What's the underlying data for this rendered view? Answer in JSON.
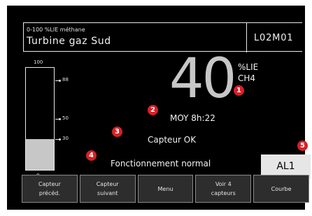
{
  "header": {
    "range_label": "0-100 %LIE méthane",
    "sensor_name": "Turbine gaz Sud",
    "sensor_code": "L02M01"
  },
  "gauge": {
    "scale_max": "100",
    "scale_min": "0",
    "level_percent": 30,
    "ticks": [
      {
        "value": 88,
        "label": "88"
      },
      {
        "value": 50,
        "label": "50"
      },
      {
        "value": 30,
        "label": "30"
      }
    ]
  },
  "reading": {
    "value": "40",
    "unit": "%LIE",
    "gas": "CH4",
    "average": "MOY 8h:22"
  },
  "status": {
    "sensor": "Capteur OK",
    "operation": "Fonctionnement normal"
  },
  "alarm": {
    "label": "AL1"
  },
  "markers": [
    "1",
    "2",
    "3",
    "4",
    "5"
  ],
  "softkeys": [
    {
      "id": "prev",
      "label": "Capteur\nprécéd."
    },
    {
      "id": "next",
      "label": "Capteur\nsuivant"
    },
    {
      "id": "menu",
      "label": "Menu"
    },
    {
      "id": "view4",
      "label": "Voir 4\ncapteurs"
    },
    {
      "id": "curve",
      "label": "Courbe"
    }
  ],
  "colors": {
    "background": "#000000",
    "value_grey": "#c7c7c7",
    "marker_red": "#d52026",
    "alarm_box": "#e6e6e6"
  }
}
